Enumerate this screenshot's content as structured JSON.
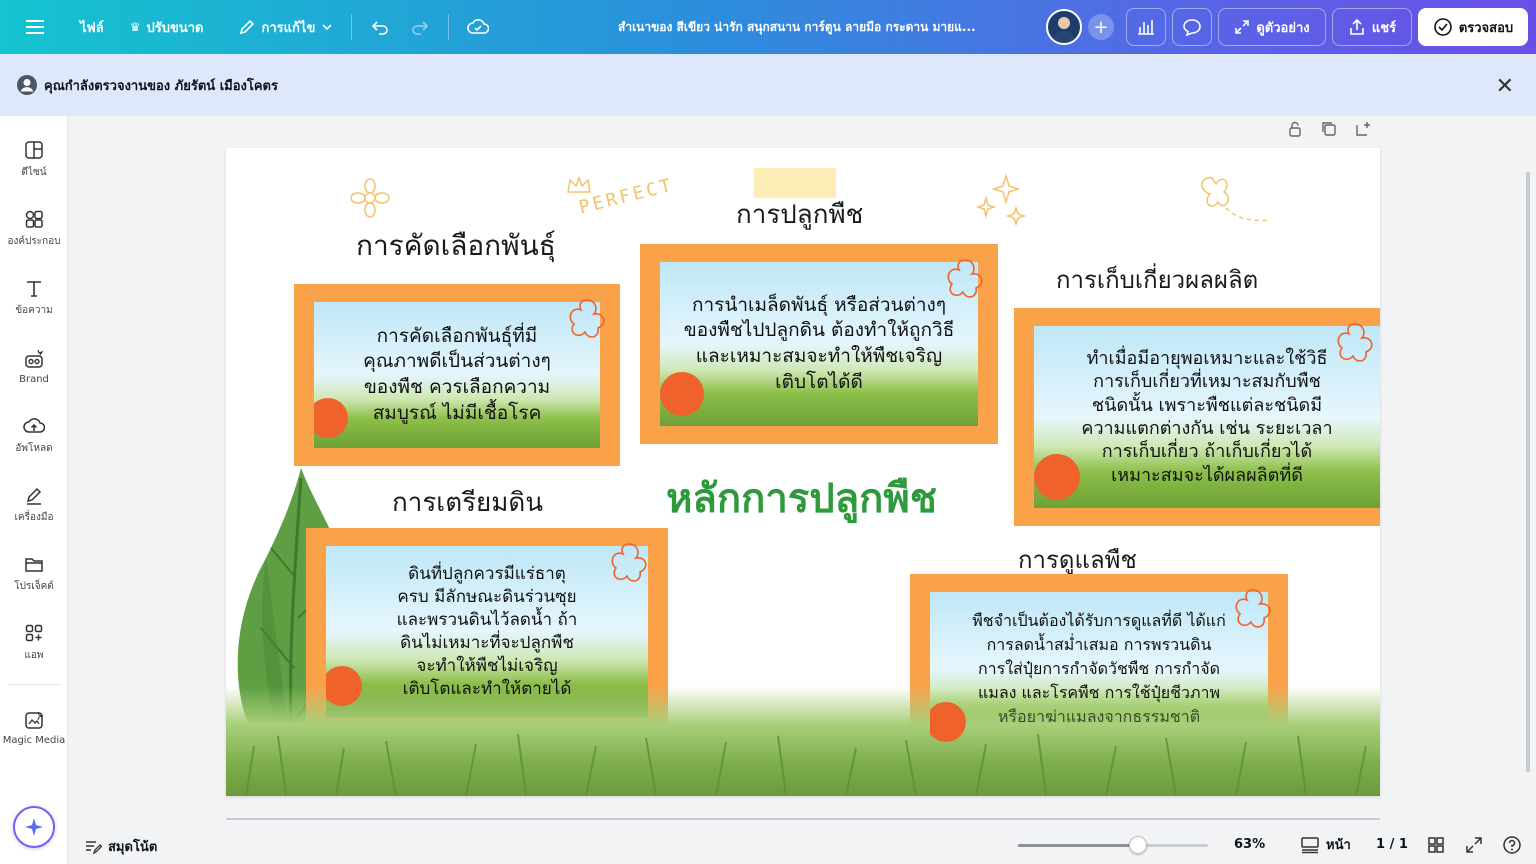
{
  "topbar": {
    "file_label": "ไฟล์",
    "resize_label": "ปรับขนาด",
    "edit_label": "การแก้ไข",
    "doc_title": "สำเนาของ สีเขียว น่ารัก สนุกสนาน การ์ตูน ลายมือ กระดาน มายแ...",
    "preview_label": "ดูตัวอย่าง",
    "share_label": "แชร์",
    "review_label": "ตรวจสอบ"
  },
  "banner": {
    "text": "คุณกำลังตรวจงานของ ภัยรัตน์ เมืองโคตร"
  },
  "sidebar": {
    "items": [
      {
        "label": "ดีไซน์",
        "icon": "layout-icon"
      },
      {
        "label": "องค์ประกอบ",
        "icon": "elements-icon"
      },
      {
        "label": "ข้อความ",
        "icon": "text-icon"
      },
      {
        "label": "Brand",
        "icon": "brand-icon"
      },
      {
        "label": "อัพโหลด",
        "icon": "upload-cloud-icon"
      },
      {
        "label": "เครื่องมือ",
        "icon": "pen-icon"
      },
      {
        "label": "โปรเจ็คต์",
        "icon": "folder-icon"
      },
      {
        "label": "แอพ",
        "icon": "apps-icon"
      },
      {
        "label": "Magic Media",
        "icon": "magic-media-icon"
      }
    ]
  },
  "slide": {
    "main_title": "หลักการปลูกพืช",
    "deco_text": "PERFECT",
    "sections": [
      {
        "heading": "การคัดเลือกพันธุ์",
        "lines": [
          "การคัดเลือกพันธุ์ที่มี",
          "คุณภาพดีเป็นส่วนต่างๆ",
          "ของพืช ควรเลือกความ",
          "สมบูรณ์ ไม่มีเชื้อโรค"
        ]
      },
      {
        "heading": "การปลูกพืช",
        "lines": [
          "การนำเมล็ดพันธุ์ หรือส่วนต่างๆ",
          "ของพืชไปปลูกดิน ต้องทำให้ถูกวิธี",
          "และเหมาะสมจะทำให้พืชเจริญ",
          "เติบโตได้ดี"
        ]
      },
      {
        "heading": "การเก็บเกี่ยวผลผลิต",
        "lines": [
          "ทำเมื่อมีอายุพอเหมาะและใช้วิธี",
          "การเก็บเกี่ยวที่เหมาะสมกับพืช",
          "ชนิดนั้น เพราะพืชแต่ละชนิดมี",
          "ความแตกต่างกัน เช่น ระยะเวลา",
          "การเก็บเกี่ยว ถ้าเก็บเกี่ยวได้",
          "เหมาะสมจะได้ผลผลิตที่ดี"
        ]
      },
      {
        "heading": "การเตรียมดิน",
        "lines": [
          "ดินที่ปลูกควรมีแร่ธาตุ",
          "ครบ มีลักษณะดินร่วนซุย",
          "และพรวนดินไว้ลดน้ำ ถ้า",
          "ดินไม่เหมาะที่จะปลูกพืช",
          "จะทำให้พืชไม่เจริญ",
          "เติบโตและทำให้ตายได้"
        ]
      },
      {
        "heading": "การดูแลพืช",
        "lines": [
          "พืชจำเป็นต้องได้รับการดูแลที่ดี ได้แก่",
          "การลดน้ำสม่ำเสมอ การพรวนดิน",
          "การใส่ปุ๋ยการกำจัดวัชพืช การกำจัด",
          "แมลง และโรคพืช การใช้ปุ๋ยชีวภาพ",
          "หรือยาฆ่าแมลงจากธรรมชาติ"
        ]
      }
    ]
  },
  "bottombar": {
    "notes_label": "สมุดโน้ต",
    "zoom_value": "63%",
    "zoom_fraction": 0.63,
    "pages_label": "หน้า",
    "page_count": "1 / 1"
  },
  "colors": {
    "card_orange": "#f9a24a",
    "title_green": "#2f9a3c",
    "review_blue_banner": "#dfe8fb"
  }
}
